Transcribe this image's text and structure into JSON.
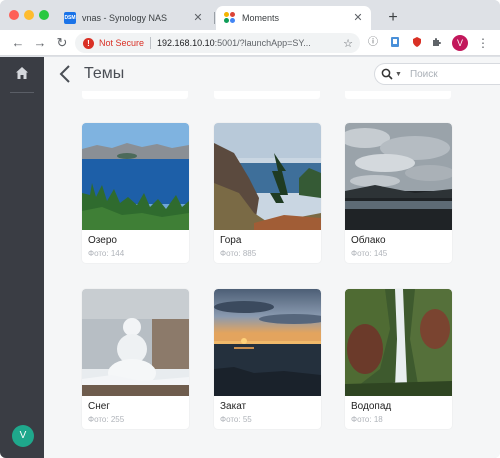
{
  "browser": {
    "tabs": [
      {
        "title": "vnas - Synology NAS",
        "favicon_text": "DSM"
      },
      {
        "title": "Moments"
      }
    ],
    "new_tab_symbol": "+",
    "security_label": "Not Secure",
    "url_host": "192.168.10.10",
    "url_rest": ":5001/?launchApp=SY...",
    "profile_initial": "V"
  },
  "app": {
    "page_title": "Темы",
    "search_placeholder": "Поиск",
    "user_initial": "V",
    "accent_color": "#1fa88c"
  },
  "topics": [
    {
      "name": "Озеро",
      "count": "Фото: 144",
      "scene": "lake"
    },
    {
      "name": "Гора",
      "count": "Фото: 885",
      "scene": "mountain"
    },
    {
      "name": "Облако",
      "count": "Фото: 145",
      "scene": "cloud"
    },
    {
      "name": "Снег",
      "count": "Фото: 255",
      "scene": "snow"
    },
    {
      "name": "Закат",
      "count": "Фото: 55",
      "scene": "sunset"
    },
    {
      "name": "Водопад",
      "count": "Фото: 18",
      "scene": "waterfall"
    }
  ]
}
